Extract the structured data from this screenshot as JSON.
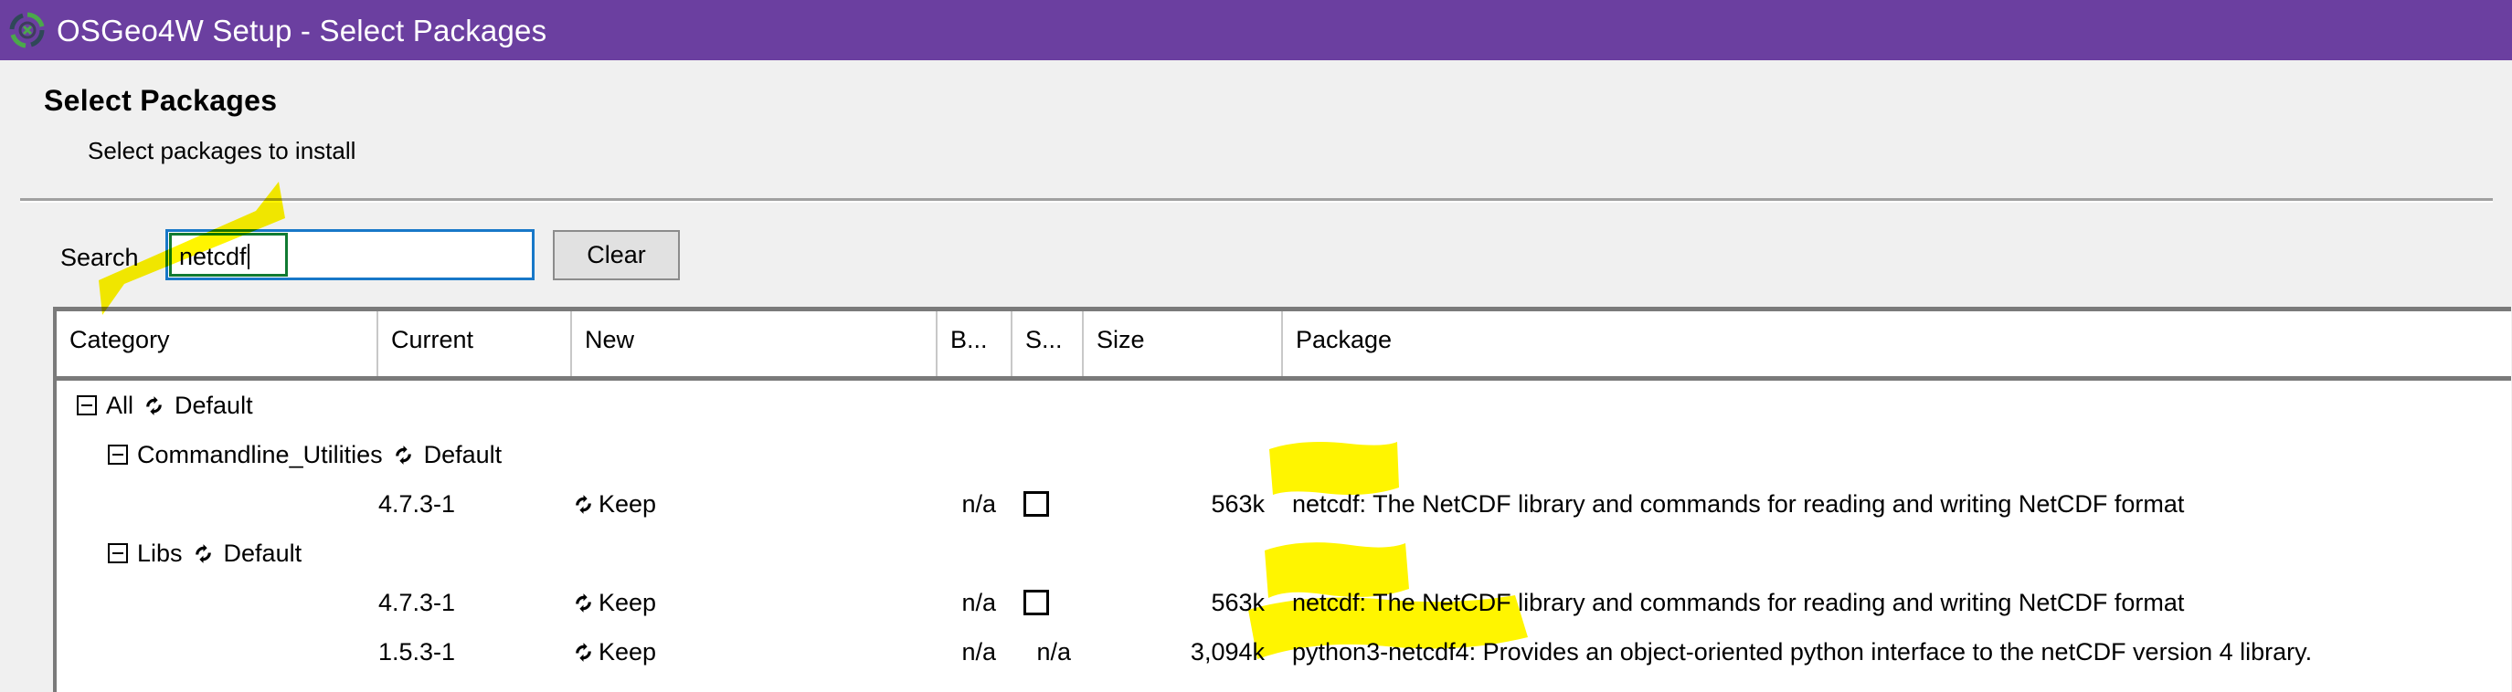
{
  "window": {
    "title": "OSGeo4W Setup - Select Packages",
    "icon": "osgeo-logo-icon",
    "titlebar_color": "#6B3FA0"
  },
  "header": {
    "title": "Select Packages",
    "subtitle": "Select packages to install"
  },
  "search": {
    "label": "Search",
    "value": "netcdf",
    "placeholder": "",
    "clear_label": "Clear",
    "focus_border_color": "#1878C8",
    "selection_border_color": "#107A32"
  },
  "table": {
    "columns": [
      {
        "key": "category",
        "label": "Category"
      },
      {
        "key": "current",
        "label": "Current"
      },
      {
        "key": "new",
        "label": "New"
      },
      {
        "key": "bin",
        "label": "B..."
      },
      {
        "key": "src",
        "label": "S..."
      },
      {
        "key": "size",
        "label": "Size"
      },
      {
        "key": "package",
        "label": "Package"
      }
    ],
    "rows": [
      {
        "kind": "group",
        "indent": 0,
        "expander": "collapse-minus-icon",
        "name": "All",
        "icon": "cycle-arrows-icon",
        "action": "Default"
      },
      {
        "kind": "group",
        "indent": 1,
        "expander": "collapse-minus-icon",
        "name": "Commandline_Utilities",
        "icon": "cycle-arrows-icon",
        "action": "Default"
      },
      {
        "kind": "package",
        "current": "4.7.3-1",
        "new_icon": "cycle-arrows-icon",
        "new": "Keep",
        "bin": "n/a",
        "src": "checkbox-unchecked",
        "size": "563k",
        "package_name": "netcdf:",
        "package_desc": "The NetCDF library and commands for reading and writing NetCDF format",
        "highlighted": true
      },
      {
        "kind": "group",
        "indent": 1,
        "expander": "collapse-minus-icon",
        "name": "Libs",
        "icon": "cycle-arrows-icon",
        "action": "Default"
      },
      {
        "kind": "package",
        "current": "4.7.3-1",
        "new_icon": "cycle-arrows-icon",
        "new": "Keep",
        "bin": "n/a",
        "src": "checkbox-unchecked",
        "size": "563k",
        "package_name": "netcdf:",
        "package_desc": "The NetCDF library and commands for reading and writing NetCDF format",
        "highlighted": true
      },
      {
        "kind": "package",
        "current": "1.5.3-1",
        "new_icon": "cycle-arrows-icon",
        "new": "Keep",
        "bin": "n/a",
        "src": "n/a",
        "size": "3,094k",
        "package_name": "python3-netcdf4:",
        "package_desc": "Provides an object-oriented python interface to the netCDF version 4 library.",
        "highlighted": true
      }
    ]
  },
  "annotations": {
    "highlighter_color": "#FFF500",
    "strokes": [
      "search-field-diagonal-stroke",
      "netcdf-package-name-row1",
      "netcdf-package-name-row2",
      "python3-netcdf4-package-name-row3"
    ]
  }
}
